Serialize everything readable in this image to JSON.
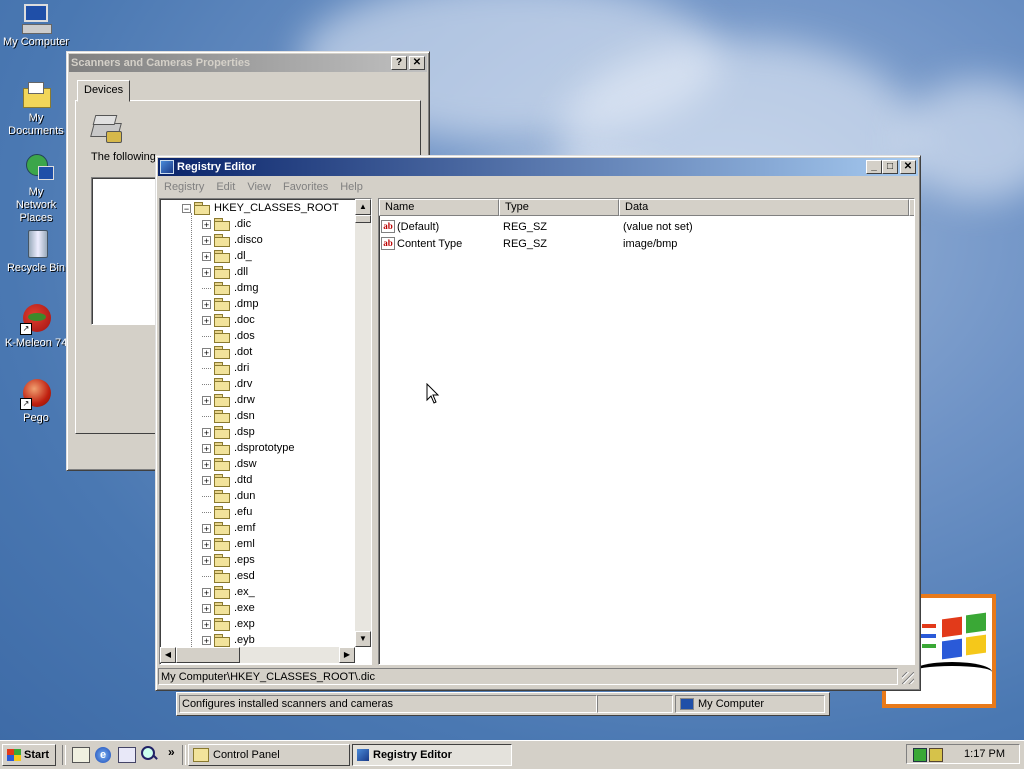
{
  "desktop": {
    "icons": [
      {
        "label": "My Computer"
      },
      {
        "label": "My Documents"
      },
      {
        "label": "My Network Places"
      },
      {
        "label": "Recycle Bin"
      },
      {
        "label": "K-Meleon 74"
      },
      {
        "label": "Pego"
      }
    ]
  },
  "scanners_window": {
    "title": "Scanners and Cameras Properties",
    "tab": "Devices",
    "text": "The following",
    "status_left": "Configures installed scanners and cameras",
    "status_right": "My Computer"
  },
  "regedit": {
    "title": "Registry Editor",
    "menu": [
      "Registry",
      "Edit",
      "View",
      "Favorites",
      "Help"
    ],
    "tree_root": "HKEY_CLASSES_ROOT",
    "tree_items": [
      {
        "label": ".dic",
        "expandable": true
      },
      {
        "label": ".disco",
        "expandable": true
      },
      {
        "label": ".dl_",
        "expandable": true
      },
      {
        "label": ".dll",
        "expandable": true
      },
      {
        "label": ".dmg",
        "expandable": false
      },
      {
        "label": ".dmp",
        "expandable": true
      },
      {
        "label": ".doc",
        "expandable": true
      },
      {
        "label": ".dos",
        "expandable": false
      },
      {
        "label": ".dot",
        "expandable": true
      },
      {
        "label": ".dri",
        "expandable": false
      },
      {
        "label": ".drv",
        "expandable": false
      },
      {
        "label": ".drw",
        "expandable": true
      },
      {
        "label": ".dsn",
        "expandable": false
      },
      {
        "label": ".dsp",
        "expandable": true
      },
      {
        "label": ".dsprototype",
        "expandable": true
      },
      {
        "label": ".dsw",
        "expandable": true
      },
      {
        "label": ".dtd",
        "expandable": true
      },
      {
        "label": ".dun",
        "expandable": false
      },
      {
        "label": ".efu",
        "expandable": false
      },
      {
        "label": ".emf",
        "expandable": true
      },
      {
        "label": ".eml",
        "expandable": true
      },
      {
        "label": ".eps",
        "expandable": true
      },
      {
        "label": ".esd",
        "expandable": false
      },
      {
        "label": ".ex_",
        "expandable": true
      },
      {
        "label": ".exe",
        "expandable": true
      },
      {
        "label": ".exp",
        "expandable": true
      },
      {
        "label": ".eyb",
        "expandable": true
      }
    ],
    "columns": [
      "Name",
      "Type",
      "Data"
    ],
    "values": [
      {
        "name": "(Default)",
        "type": "REG_SZ",
        "data": "(value not set)"
      },
      {
        "name": "Content Type",
        "type": "REG_SZ",
        "data": "image/bmp"
      }
    ],
    "status": "My Computer\\HKEY_CLASSES_ROOT\\.dic"
  },
  "taskbar": {
    "start_label": "Start",
    "tasks": [
      {
        "label": "Control Panel",
        "active": false
      },
      {
        "label": "Registry Editor",
        "active": true
      }
    ],
    "clock": "1:17 PM"
  },
  "colors": {
    "title_active": "#0a246a",
    "title_inactive": "#808080",
    "face": "#d4d0c8",
    "desktop": "#4a78b2"
  }
}
